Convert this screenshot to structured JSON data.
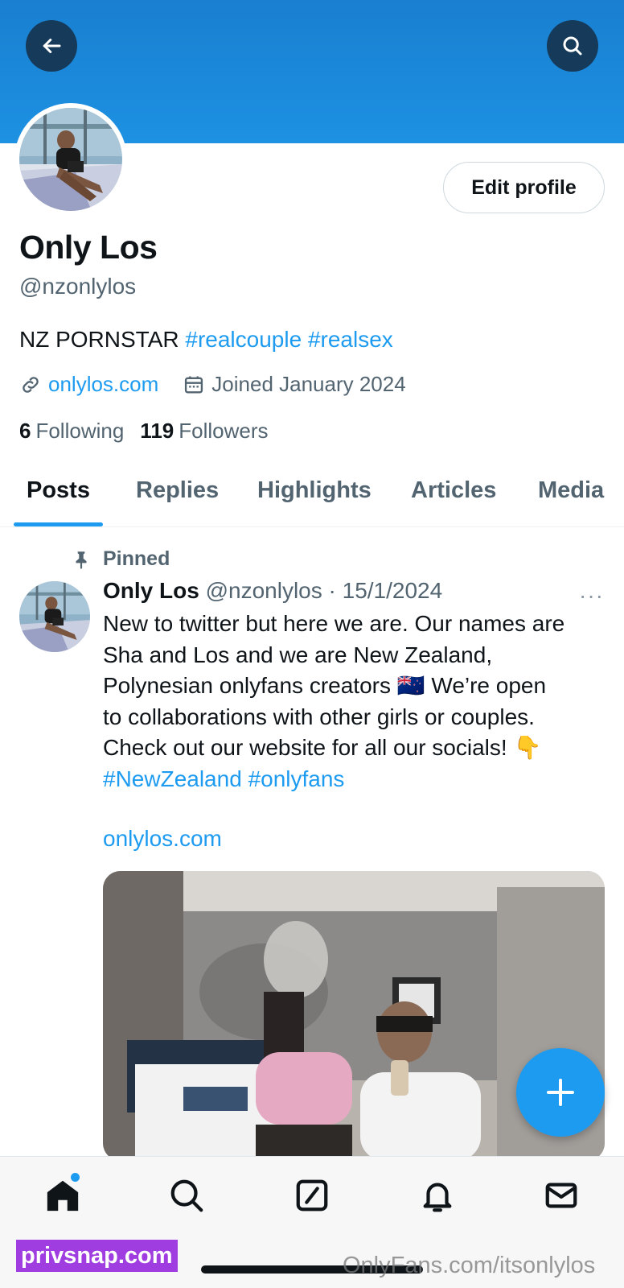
{
  "header": {
    "back_icon": "arrow-left-icon",
    "search_icon": "search-icon",
    "banner_color": "#1d91e2"
  },
  "profile": {
    "edit_label": "Edit profile",
    "name": "Only Los",
    "handle": "@nzonlylos",
    "bio_text": "NZ PORNSTAR ",
    "bio_tags": [
      "#realcouple",
      "#realsex"
    ],
    "website": "onlylos.com",
    "joined": "Joined January 2024",
    "following_count": "6",
    "following_label": "Following",
    "followers_count": "119",
    "followers_label": "Followers"
  },
  "tabs": [
    {
      "label": "Posts",
      "active": true
    },
    {
      "label": "Replies",
      "active": false
    },
    {
      "label": "Highlights",
      "active": false
    },
    {
      "label": "Articles",
      "active": false
    },
    {
      "label": "Media",
      "active": false
    }
  ],
  "post": {
    "pinned_label": "Pinned",
    "author_name": "Only Los",
    "author_handle": "@nzonlylos",
    "date": "· 15/1/2024",
    "more_label": "···",
    "text_lines": [
      "New to twitter but here we are. Our names are",
      "Sha and Los and we are New Zealand,",
      "Polynesian onlyfans creators 🇳🇿 We’re open",
      "to collaborations with other girls or couples.",
      "Check out our website for all our socials!  👇"
    ],
    "hashtags": [
      "#NewZealand",
      "#onlyfans"
    ],
    "link": "onlylos.com"
  },
  "bottom_nav": {
    "items": [
      "home-icon",
      "search-icon",
      "grok-icon",
      "bell-icon",
      "mail-icon"
    ],
    "active": "home-icon"
  },
  "watermarks": {
    "left": "privsnap.com",
    "right": "OnlyFans.com/itsonlylos"
  },
  "colors": {
    "accent": "#1d9bf0",
    "text": "#0f1419",
    "secondary": "#536471"
  }
}
